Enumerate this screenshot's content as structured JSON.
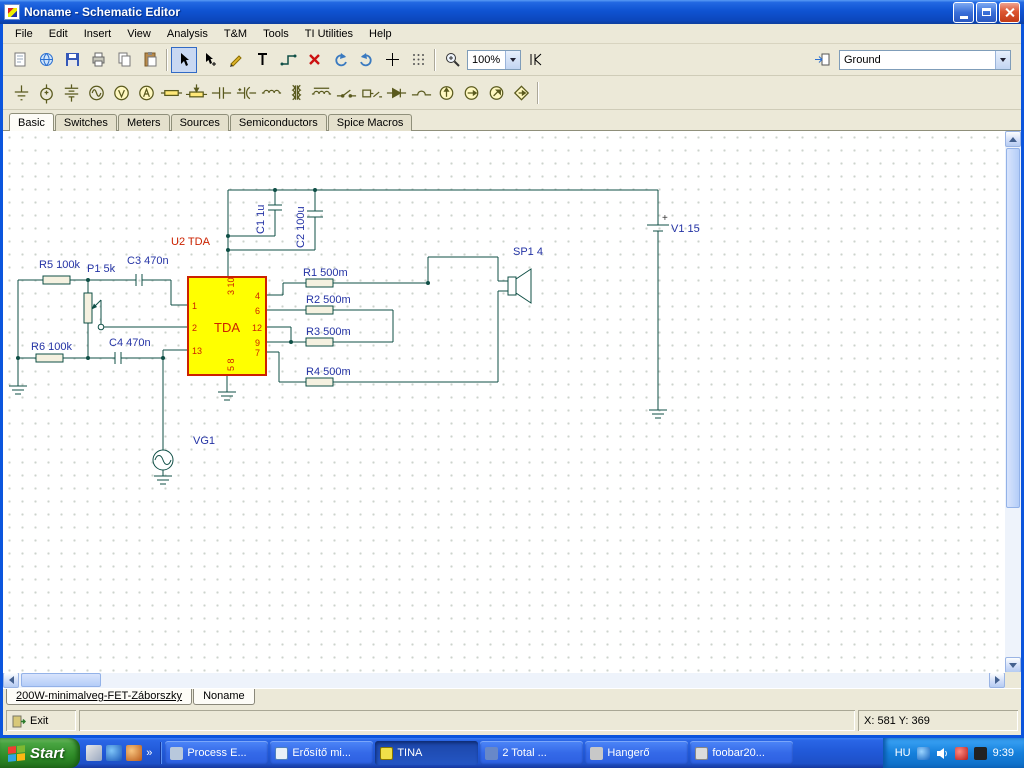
{
  "titlebar": {
    "title": "Noname - Schematic Editor"
  },
  "menu": {
    "items": [
      "File",
      "Edit",
      "Insert",
      "View",
      "Analysis",
      "T&M",
      "Tools",
      "TI Utilities",
      "Help"
    ]
  },
  "toolbar": {
    "zoom_value": "100%",
    "component_select": "Ground"
  },
  "component_tabs": [
    "Basic",
    "Switches",
    "Meters",
    "Sources",
    "Semiconductors",
    "Spice Macros"
  ],
  "schematic": {
    "labels": {
      "c1": "C1 1u",
      "c2": "C2 100u",
      "v1": "V1 15",
      "v1_plus": "+",
      "u2": "U2 TDA",
      "ic_name": "TDA",
      "pin1": "1",
      "pin2": "2",
      "pin13": "13",
      "pin4": "4",
      "pin6": "6",
      "pin12": "12",
      "pin9": "9",
      "pin7": "7",
      "pins_top": "3 10",
      "pins_bottom": "5 8",
      "r5": "R5 100k",
      "p1": "P1 5k",
      "c3": "C3 470n",
      "r6": "R6 100k",
      "c4": "C4 470n",
      "r1": "R1 500m",
      "r2": "R2 500m",
      "r3": "R3 500m",
      "r4": "R4 500m",
      "sp1": "SP1 4",
      "vg1": "VG1"
    },
    "colors": {
      "wire": "#0f4f46",
      "label_blue": "#2433a5",
      "ic_fill": "#ffff00",
      "ic_border": "#cc2200",
      "red_label": "#cc2200"
    }
  },
  "doc_tabs": [
    "200W-minimalveg-FET-Záborszky",
    "Noname"
  ],
  "statusbar": {
    "exit_label": "Exit",
    "coordinates": "X: 581 Y: 369"
  },
  "taskbar": {
    "start_label": "Start",
    "quicklaunch_overflow": "»",
    "tasks": [
      {
        "label": "Process E..."
      },
      {
        "label": "Erősítő mi..."
      },
      {
        "label": "TINA"
      },
      {
        "label": "2 Total ..."
      },
      {
        "label": "Hangerő"
      },
      {
        "label": "foobar20..."
      }
    ],
    "tray": {
      "language": "HU",
      "time": "9:39"
    }
  }
}
